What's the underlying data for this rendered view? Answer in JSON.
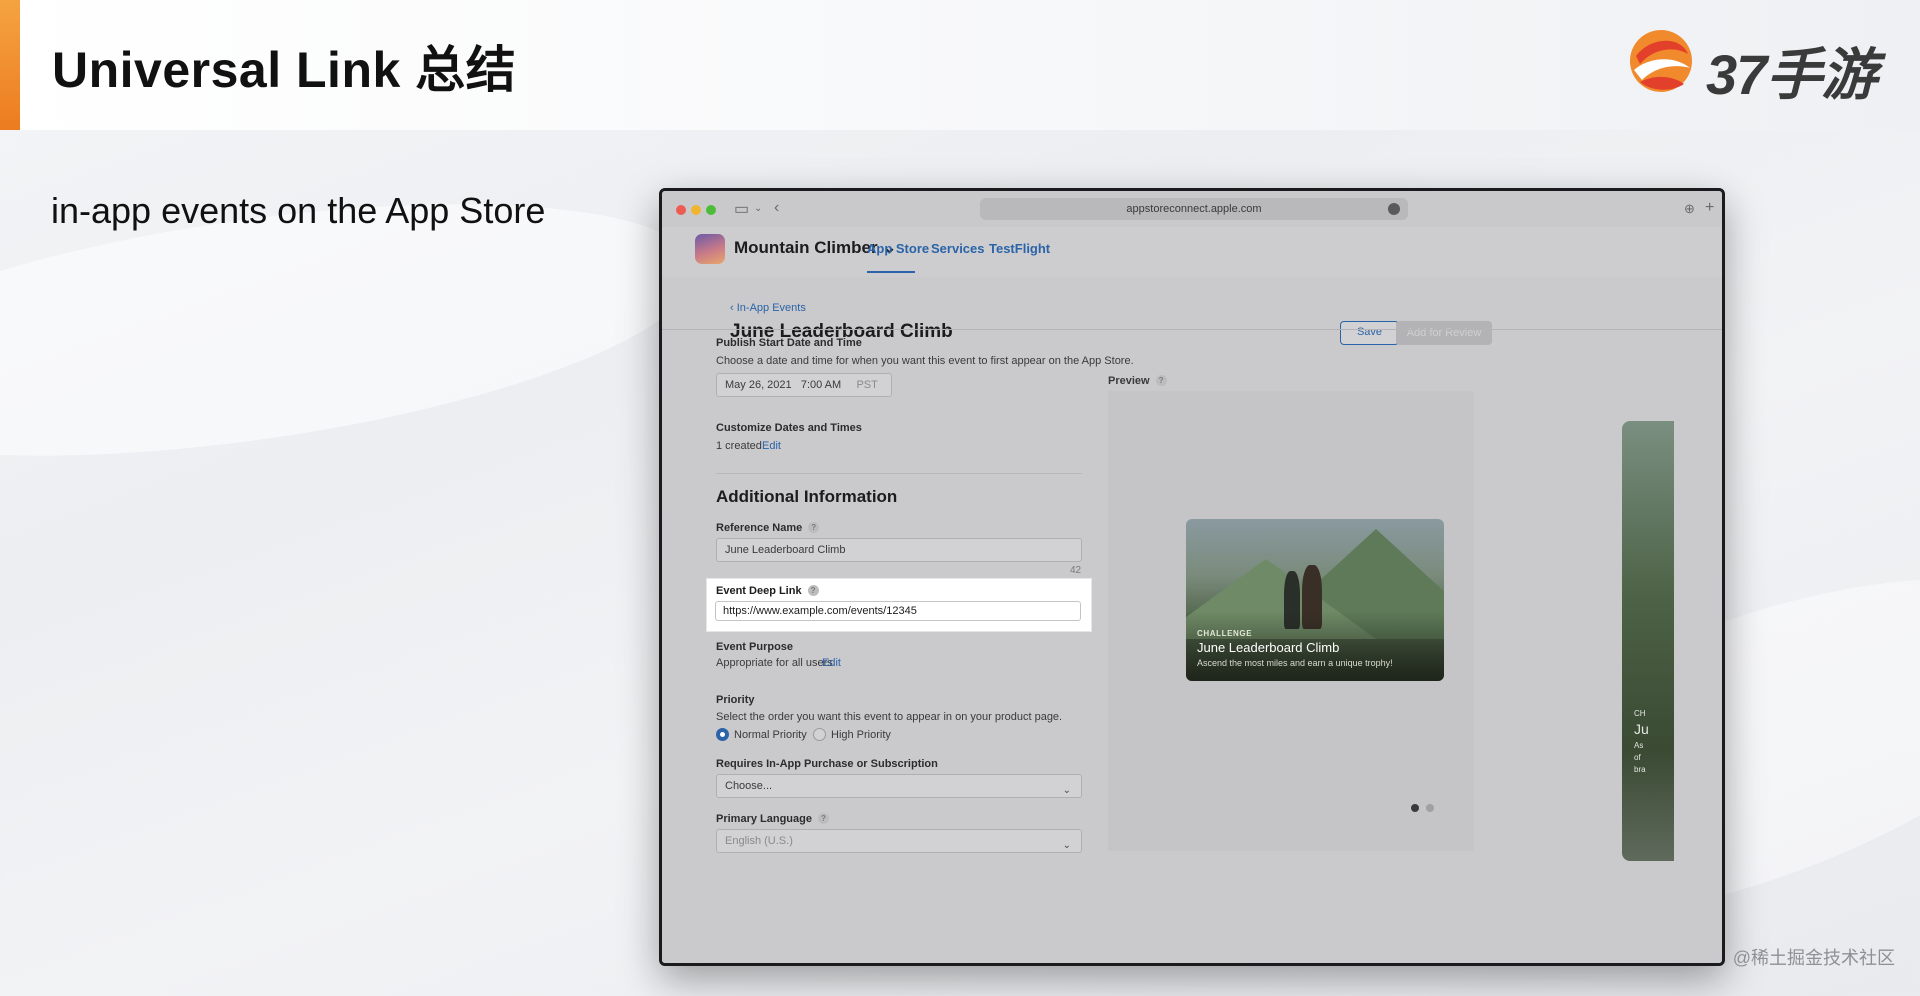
{
  "slide": {
    "title": "Universal Link 总结",
    "subtitle": "in-app events on the App Store",
    "logo_text": "37手游",
    "watermark": "@稀土掘金技术社区",
    "accent_color": "#f08a2c"
  },
  "browser": {
    "url": "appstoreconnect.apple.com"
  },
  "app_nav": {
    "app_name": "Mountain Climber",
    "tabs": [
      "App Store",
      "Services",
      "TestFlight"
    ],
    "active_tab": "App Store"
  },
  "page": {
    "breadcrumb": "In-App Events",
    "title": "June Leaderboard Climb",
    "save_label": "Save",
    "review_label": "Add for Review"
  },
  "form": {
    "publish_start": {
      "label": "Publish Start Date and Time",
      "description": "Choose a date and time for when you want this event to first appear on the App Store.",
      "date": "May 26, 2021",
      "time": "7:00 AM",
      "timezone": "PST"
    },
    "custom_dates": {
      "label": "Customize Dates and Times",
      "value": "1 created",
      "edit": "Edit"
    },
    "additional_info_title": "Additional Information",
    "reference_name": {
      "label": "Reference Name",
      "value": "June Leaderboard Climb",
      "remaining": "42"
    },
    "deep_link": {
      "label": "Event Deep Link",
      "value": "https://www.example.com/events/12345"
    },
    "purpose": {
      "label": "Event Purpose",
      "value": "Appropriate for all users",
      "edit": "Edit"
    },
    "priority": {
      "label": "Priority",
      "description": "Select the order you want this event to appear in on your product page.",
      "options": [
        "Normal Priority",
        "High Priority"
      ],
      "selected": "Normal Priority"
    },
    "requires_purchase": {
      "label": "Requires In-App Purchase or Subscription",
      "value": "Choose..."
    },
    "primary_language": {
      "label": "Primary Language",
      "value": "English (U.S.)"
    }
  },
  "preview": {
    "label": "Preview",
    "card": {
      "eyebrow": "CHALLENGE",
      "title": "June Leaderboard Climb",
      "description": "Ascend the most miles and earn a unique trophy!"
    },
    "side_card": {
      "eyebrow": "CH",
      "title": "Ju",
      "lines": [
        "As",
        "of",
        "bra"
      ]
    },
    "page_dots": 2,
    "active_dot": 1
  }
}
